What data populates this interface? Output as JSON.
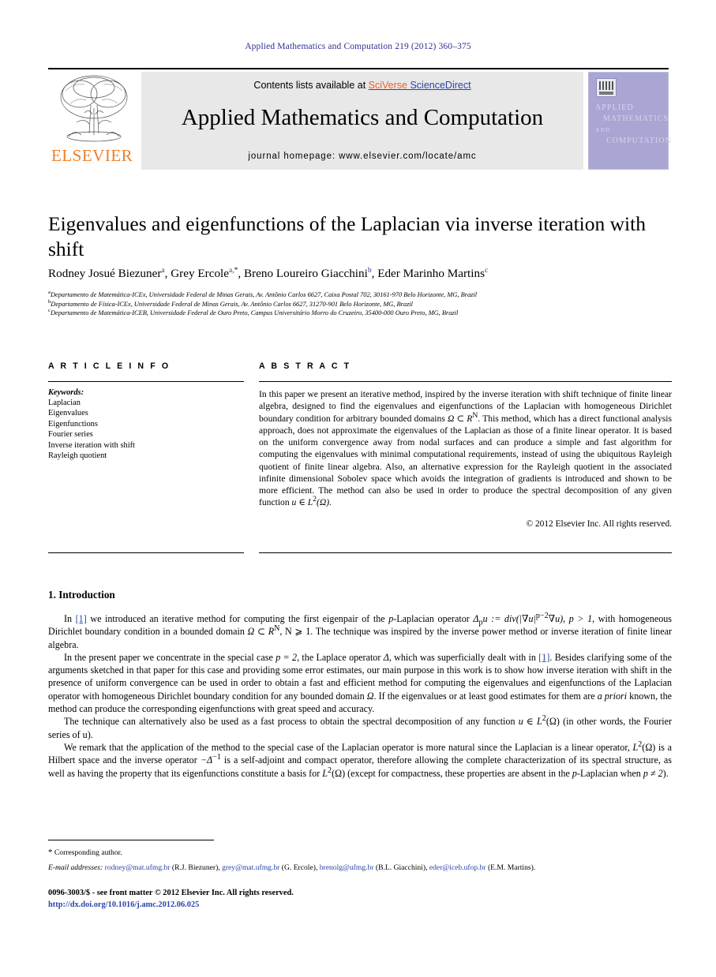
{
  "running_head": "Applied Mathematics and Computation 219 (2012) 360–375",
  "masthead": {
    "contents_prefix": "Contents lists available at ",
    "sciverse": "SciVerse",
    "sciencedirect": " ScienceDirect",
    "journal_title": "Applied Mathematics and Computation",
    "homepage": "journal homepage: www.elsevier.com/locate/amc",
    "publisher": "ELSEVIER",
    "cover": {
      "line1": "APPLIED",
      "line2": "MATHEMATICS",
      "line3": "AND",
      "line4": "COMPUTATION"
    }
  },
  "article": {
    "title": "Eigenvalues and eigenfunctions of the Laplacian via inverse iteration with shift",
    "authors": [
      {
        "name": "Rodney Josué Biezuner",
        "sup": "a",
        "sep": ", "
      },
      {
        "name": "Grey Ercole",
        "sup": "a,",
        "star": "*",
        "sep": ", "
      },
      {
        "name": "Breno Loureiro Giacchini",
        "sup": "b",
        "sep": ", "
      },
      {
        "name": "Eder Marinho Martins",
        "sup": "c",
        "sep": ""
      }
    ],
    "affiliations": [
      {
        "mark": "a",
        "text": "Departamento de Matemática-ICEx, Universidade Federal de Minas Gerais, Av. Antônio Carlos 6627, Caixa Postal 702, 30161-970 Belo Horizonte, MG, Brazil"
      },
      {
        "mark": "b",
        "text": "Departamento de Física-ICEx, Universidade Federal de Minas Gerais, Av. Antônio Carlos 6627, 31270-901 Belo Horizonte, MG, Brazil"
      },
      {
        "mark": "c",
        "text": "Departamento de Matemática-ICEB, Universidade Federal de Ouro Preto, Campus Universitário Morro do Cruzeiro, 35400-000 Ouro Preto, MG, Brazil"
      }
    ]
  },
  "info": {
    "heading": "A R T I C L E  I N F O",
    "keywords_label": "Keywords:",
    "keywords": [
      "Laplacian",
      "Eigenvalues",
      "Eigenfunctions",
      "Fourier series",
      "Inverse iteration with shift",
      "Rayleigh quotient"
    ]
  },
  "abstract": {
    "heading": "A B S T R A C T",
    "part1": "In this paper we present an iterative method, inspired by the inverse iteration with shift technique of finite linear algebra, designed to find the eigenvalues and eigenfunctions of the Laplacian with homogeneous Dirichlet boundary condition for arbitrary bounded domains ",
    "domain_math": "Ω ⊂ R",
    "domain_sup": "N",
    "part2": ". This method, which has a direct functional analysis approach, does not approximate the eigenvalues of the Laplacian as those of a finite linear operator. It is based on the uniform convergence away from nodal surfaces and can produce a simple and fast algorithm for computing the eigenvalues with minimal computational requirements, instead of using the ubiquitous Rayleigh quotient of finite linear algebra. Also, an alternative expression for the Rayleigh quotient in the associated infinite dimensional Sobolev space which avoids the integration of gradients is introduced and shown to be more efficient. The method can also be used in order to produce the spectral decomposition of any given function ",
    "func_math": "u ∈ L",
    "func_sup": "2",
    "func_tail": "(Ω).",
    "copyright": "© 2012 Elsevier Inc. All rights reserved."
  },
  "body": {
    "section_heading": "1. Introduction",
    "p1_a": "In ",
    "p1_ref": "[1]",
    "p1_b": " we introduced an iterative method for computing the first eigenpair of the ",
    "p1_c": "p",
    "p1_d": "-Laplacian operator ",
    "p1_math": "Δ",
    "p1_math_sub": "p",
    "p1_math_b": "u := div(|∇u|",
    "p1_math_sup": "p−2",
    "p1_math_c": "∇u), p > 1",
    "p1_e": ", with homogeneous Dirichlet boundary condition in a bounded domain ",
    "p1_dom": "Ω ⊂ R",
    "p1_dom_sup": "N",
    "p1_f": ", N ⩾ 1. The technique was inspired by the inverse power method or inverse iteration of finite linear algebra.",
    "p2_a": "In the present paper we concentrate in the special case ",
    "p2_case": "p = 2",
    "p2_b": ", the Laplace operator ",
    "p2_delta": "Δ",
    "p2_c": ", which was superficially dealt with in ",
    "p2_ref": "[1]",
    "p2_d": ". Besides clarifying some of the arguments sketched in that paper for this case and providing some error estimates, our main purpose in this work is to show how inverse iteration with shift in the presence of uniform convergence can be used in order to obtain a fast and efficient method for computing the eigenvalues and eigenfunctions of the Laplacian operator with homogeneous Dirichlet boundary condition for any bounded domain ",
    "p2_omega": "Ω",
    "p2_e": ". If the eigenvalues or at least good estimates for them are ",
    "p2_apriori": "a priori",
    "p2_f": " known, the method can produce the corresponding eigenfunctions with great speed and accuracy.",
    "p3_a": "The technique can alternatively also be used as a fast process to obtain the spectral decomposition of any function ",
    "p3_math": "u ∈ L",
    "p3_sup": "2",
    "p3_b": "(Ω) (in other words, the Fourier series of u).",
    "p4_a": "We remark that the application of the method to the special case of the Laplacian operator is more natural since the Laplacian is a linear operator, ",
    "p4_l2": "L",
    "p4_l2_sup": "2",
    "p4_b": "(Ω) is a Hilbert space and the inverse operator ",
    "p4_inv": "−Δ",
    "p4_inv_sup": "−1",
    "p4_c": " is a self-adjoint and compact operator, therefore allowing the complete characterization of its spectral structure, as well as having the property that its eigenfunctions constitute a basis for ",
    "p4_l2b": "L",
    "p4_l2b_sup": "2",
    "p4_d": "(Ω) (except for compactness, these properties are absent in the ",
    "p4_plap": "p",
    "p4_e": "-Laplacian when ",
    "p4_pne": "p ≠ 2",
    "p4_f": ")."
  },
  "footer": {
    "corresponding_star": "*",
    "corresponding": " Corresponding author.",
    "emails_label": "E-mail addresses:",
    "emails": [
      {
        "address": "rodney@mat.ufmg.br",
        "owner": " (R.J. Biezuner), "
      },
      {
        "address": "grey@mat.ufmg.br",
        "owner": " (G. Ercole), "
      },
      {
        "address": "brenolg@ufmg.br",
        "owner": " (B.L. Giacchini), "
      },
      {
        "address": "eder@iceb.ufop.br",
        "owner": " (E.M. Martins)."
      }
    ],
    "imprint": "0096-3003/$ - see front matter © 2012 Elsevier Inc. All rights reserved.",
    "doi": "http://dx.doi.org/10.1016/j.amc.2012.06.025"
  },
  "colors": {
    "header_blue": "#2e3192",
    "link_blue": "#2b44a8",
    "elsevier_orange": "#f07e26",
    "masthead_grey": "#e8e8e8",
    "cover_purple": "#a9a6d4"
  }
}
